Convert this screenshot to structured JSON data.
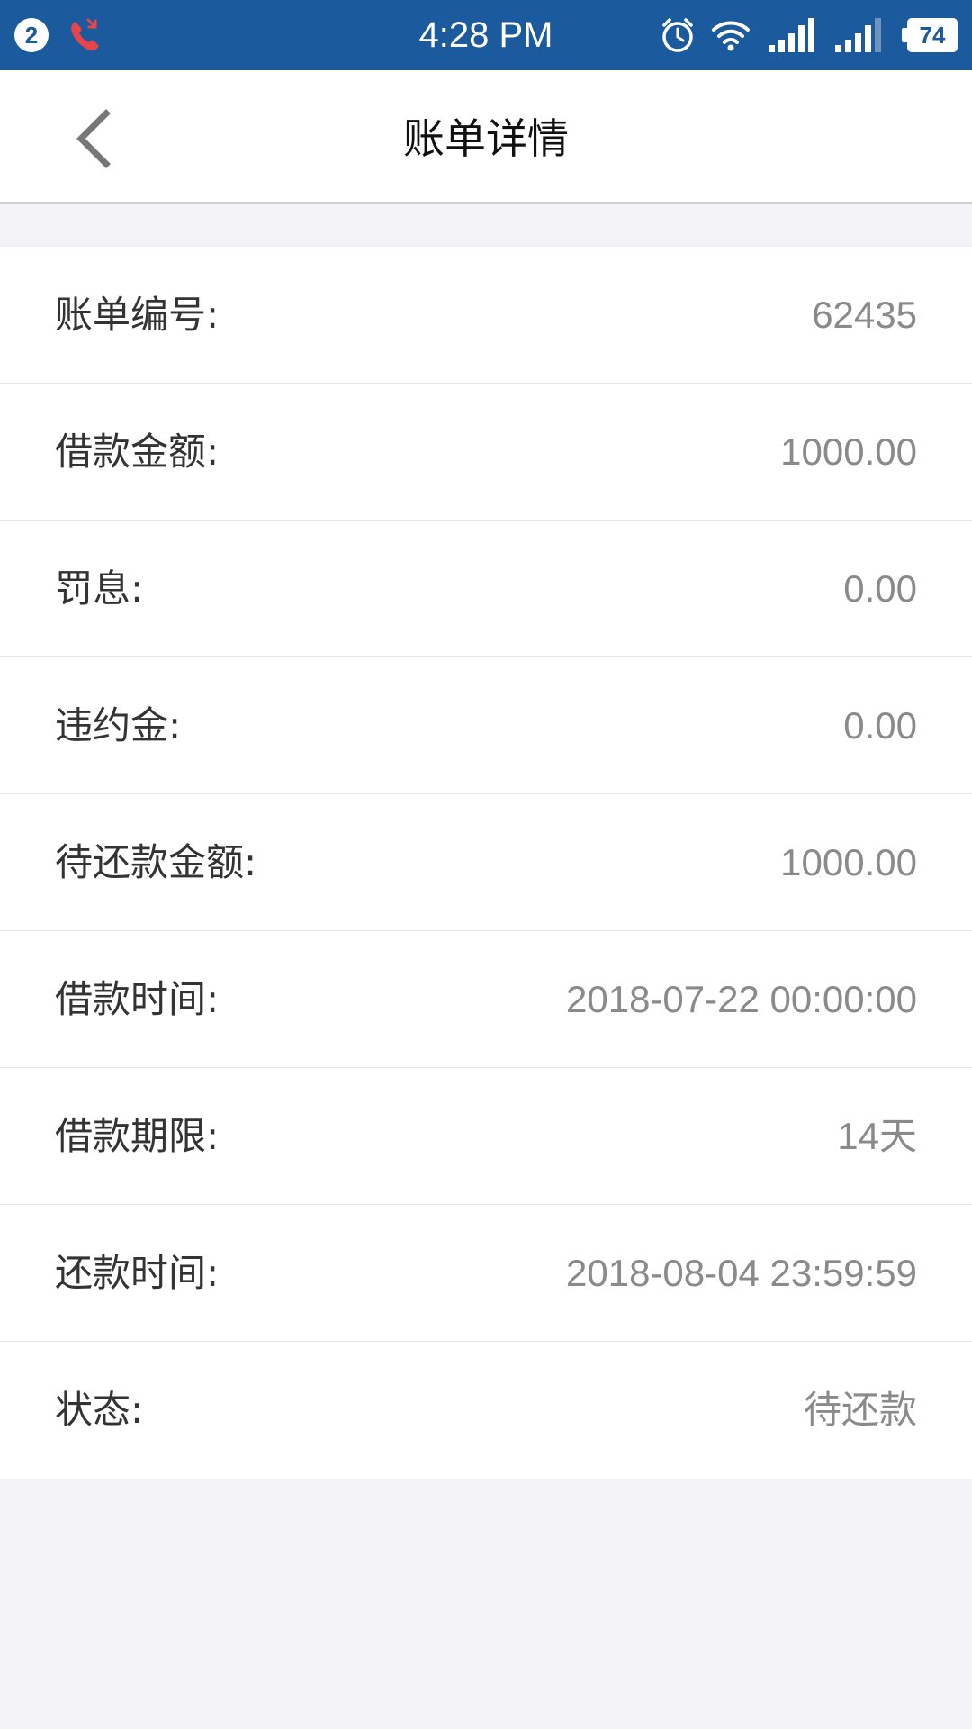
{
  "status_bar": {
    "notification_count": "2",
    "time": "4:28 PM",
    "battery": "74",
    "icons": [
      "missed-call-icon",
      "alarm-icon",
      "wifi-icon",
      "signal-icon",
      "signal-icon",
      "battery-icon"
    ]
  },
  "nav": {
    "title": "账单详情",
    "back_icon": "chevron-left-icon"
  },
  "details": [
    {
      "label": "账单编号:",
      "value": "62435"
    },
    {
      "label": "借款金额:",
      "value": "1000.00"
    },
    {
      "label": "罚息:",
      "value": "0.00"
    },
    {
      "label": "违约金:",
      "value": "0.00"
    },
    {
      "label": "待还款金额:",
      "value": "1000.00"
    },
    {
      "label": "借款时间:",
      "value": "2018-07-22 00:00:00"
    },
    {
      "label": "借款期限:",
      "value": "14天"
    },
    {
      "label": "还款时间:",
      "value": "2018-08-04 23:59:59"
    },
    {
      "label": "状态:",
      "value": "待还款"
    }
  ],
  "colors": {
    "status_bar": "#1b5a9c",
    "background": "#f2f2f7",
    "label_text": "#333333",
    "value_text": "#8a8a8a",
    "missed_call": "#e8454b"
  }
}
